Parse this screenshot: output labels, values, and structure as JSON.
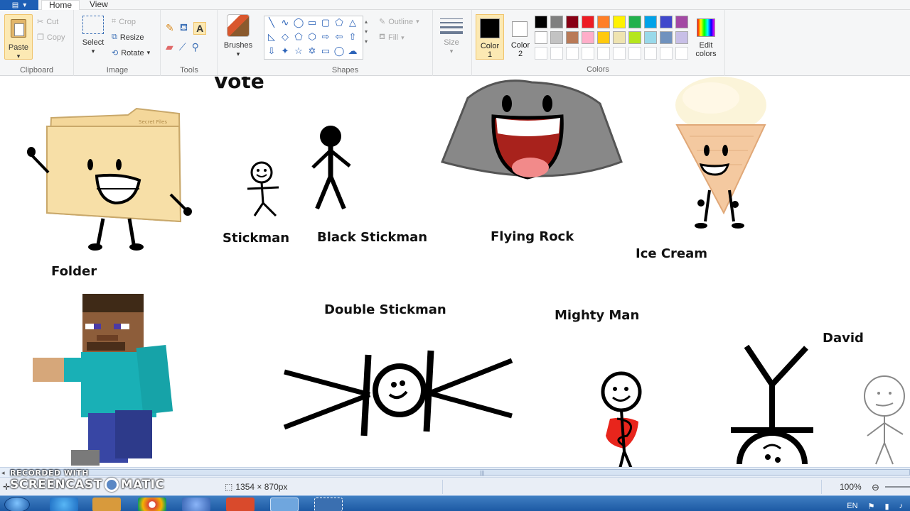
{
  "tabs": {
    "home": "Home",
    "view": "View"
  },
  "clipboard": {
    "paste": "Paste",
    "cut": "Cut",
    "copy": "Copy",
    "group": "Clipboard"
  },
  "image": {
    "select": "Select",
    "crop": "Crop",
    "resize": "Resize",
    "rotate": "Rotate",
    "group": "Image"
  },
  "tools": {
    "group": "Tools"
  },
  "brushes": {
    "label": "Brushes"
  },
  "shapes": {
    "outline": "Outline",
    "fill": "Fill",
    "group": "Shapes"
  },
  "size": {
    "label": "Size"
  },
  "colors": {
    "color1": "Color\n1",
    "color2": "Color\n2",
    "edit": "Edit\ncolors",
    "group": "Colors",
    "selected_primary": "#000000",
    "selected_secondary": "#ffffff",
    "row1": [
      "#000000",
      "#7f7f7f",
      "#880015",
      "#ed1c24",
      "#ff7f27",
      "#fff200",
      "#22b14c",
      "#00a2e8",
      "#3f48cc",
      "#a349a4"
    ],
    "row2": [
      "#ffffff",
      "#c3c3c3",
      "#b97a57",
      "#ffaec9",
      "#ffc90e",
      "#efe4b0",
      "#b5e61d",
      "#99d9ea",
      "#7092be",
      "#c8bfe7"
    ],
    "row3": [
      "",
      "",
      "",
      "",
      "",
      "",
      "",
      "",
      "",
      ""
    ]
  },
  "canvas": {
    "labels": {
      "vote": "Vote",
      "folder": "Folder",
      "stickman": "Stickman",
      "black_stickman": "Black Stickman",
      "flying_rock": "Flying Rock",
      "ice_cream": "Ice Cream",
      "double_stickman": "Double Stickman",
      "mighty_man": "Mighty Man",
      "david": "David"
    },
    "small_text": {
      "folder_tab": "Secret Files"
    }
  },
  "status": {
    "dimensions": "1354 × 870px",
    "zoom": "100%"
  },
  "watermark": {
    "line1": "RECORDED WITH",
    "line2a": "SCREENCAST",
    "line2b": "MATIC"
  },
  "tray": {
    "lang": "EN"
  }
}
